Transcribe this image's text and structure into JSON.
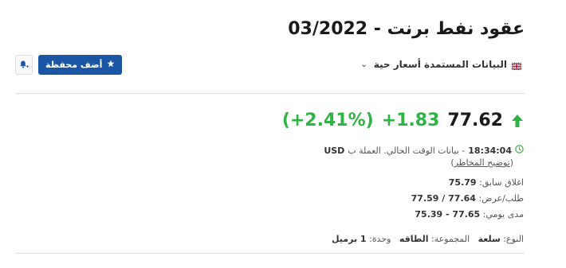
{
  "header": {
    "title_prefix": "عقود نفط برنت - ",
    "title_date": "03/2022"
  },
  "source": {
    "label": "البيانات المستمدة أسعار حية",
    "flag": "uk-flag-icon"
  },
  "actions": {
    "add_portfolio_label": "أضف محفظة",
    "alert_icon": "bell-plus-icon"
  },
  "quote": {
    "price": "77.62",
    "change": "+1.83",
    "change_pct": "(+2.41%)",
    "direction": "up",
    "up_color": "#2fb344"
  },
  "status": {
    "time": "18:34:04",
    "text": "- بيانات الوقت الحالي. العملة ب",
    "currency": "USD",
    "risk_link": "توضيح المخاطر"
  },
  "stats": {
    "prev_close_label": "اغلاق سابق:",
    "prev_close": "75.79",
    "bid_ask_label": "طلب/عرض:",
    "bid": "77.59",
    "bid_ask_sep": "/",
    "ask": "77.64",
    "day_range_label": "مدى يومي:",
    "day_range": "75.39 - 77.65"
  },
  "meta": {
    "type_label": "النوع:",
    "type_value": "سلعة",
    "group_label": "المجموعة:",
    "group_value": "الطاقه",
    "unit_label": "وحدة:",
    "unit_value": "1 برميل"
  }
}
